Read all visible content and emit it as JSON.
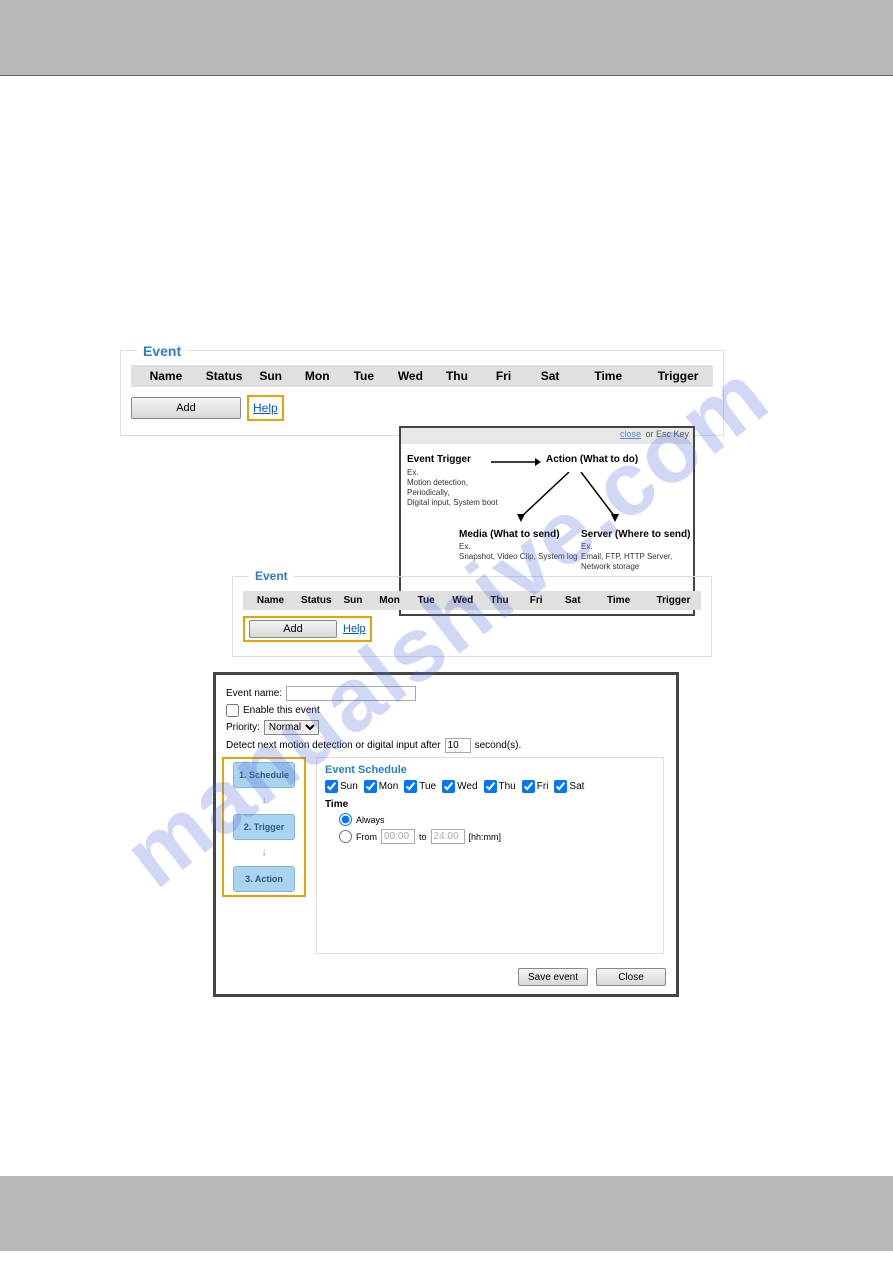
{
  "watermark": "manualshive.com",
  "panel1": {
    "legend": "Event",
    "headers": [
      "Name",
      "Status",
      "Sun",
      "Mon",
      "Tue",
      "Wed",
      "Thu",
      "Fri",
      "Sat",
      "Time",
      "Trigger"
    ],
    "add": "Add",
    "help": "Help"
  },
  "popup": {
    "close": "close",
    "esc": "or Esc Key",
    "trigger_title": "Event Trigger",
    "trigger_ex": "Ex.",
    "trigger_lines": "Motion detection, Periodically,\nDigital input, System boot",
    "action_title": "Action (What to do)",
    "media_title": "Media (What to send)",
    "media_ex": "Ex.",
    "media_lines": "Snapshot, Video Clip, System log",
    "server_title": "Server (Where to send)",
    "server_ex": "Ex.",
    "server_lines": "Email, FTP, HTTP Server,\nNetwork storage"
  },
  "panel2": {
    "legend": "Event",
    "headers": [
      "Name",
      "Status",
      "Sun",
      "Mon",
      "Tue",
      "Wed",
      "Thu",
      "Fri",
      "Sat",
      "Time",
      "Trigger"
    ],
    "add": "Add",
    "help": "Help"
  },
  "dialog": {
    "event_name_label": "Event name:",
    "enable_label": "Enable this event",
    "priority_label": "Priority:",
    "priority_value": "Normal",
    "detect_label_a": "Detect next motion detection or digital input after",
    "detect_value": "10",
    "detect_label_b": "second(s).",
    "steps": [
      "1. Schedule",
      "2. Trigger",
      "3. Action"
    ],
    "schedule_legend": "Event Schedule",
    "days": [
      "Sun",
      "Mon",
      "Tue",
      "Wed",
      "Thu",
      "Fri",
      "Sat"
    ],
    "time_label": "Time",
    "always": "Always",
    "from": "From",
    "from_val": "00:00",
    "to": "to",
    "to_val": "24:00",
    "hhmm": "[hh:mm]",
    "save": "Save event",
    "close": "Close"
  }
}
